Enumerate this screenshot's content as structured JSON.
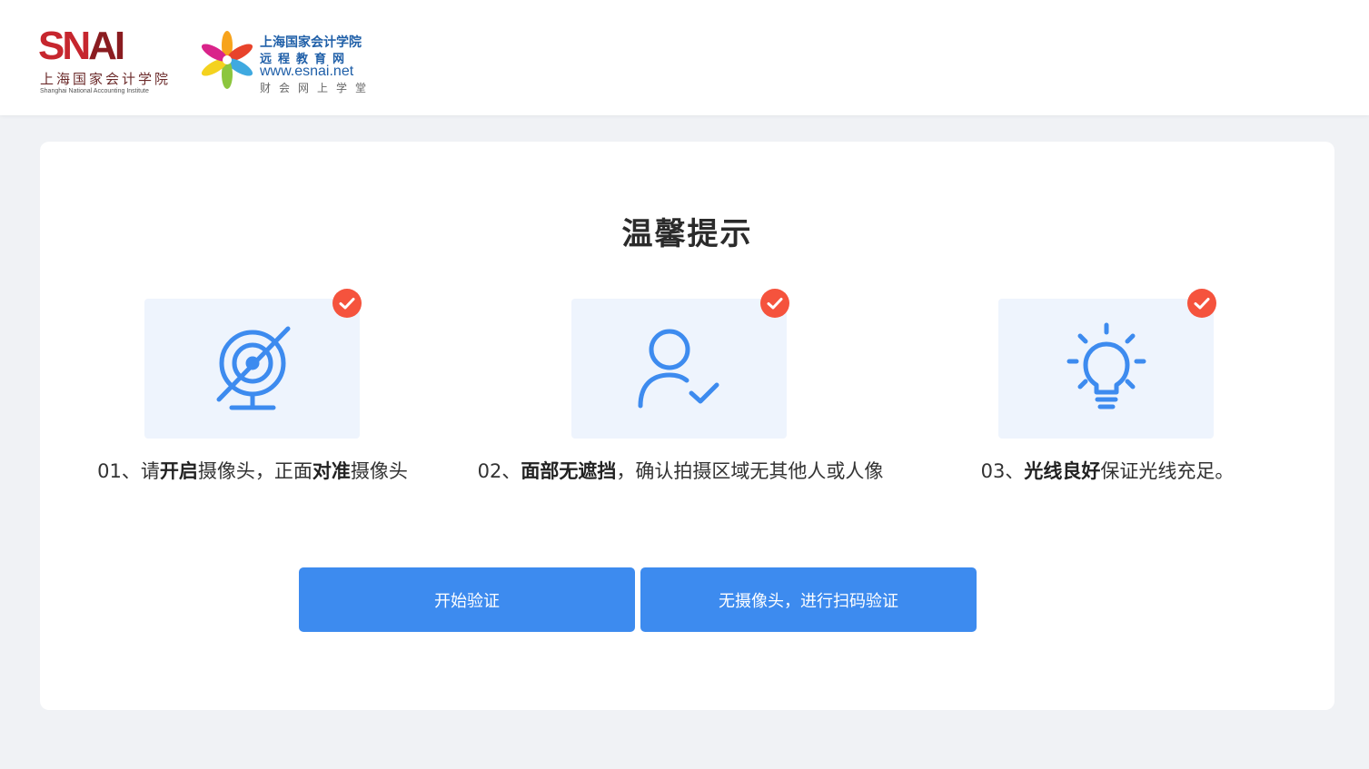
{
  "header": {
    "snai_logo": {
      "wordmark_sn": "SN",
      "wordmark_ai": "AI",
      "name_cn": "上海国家会计学院",
      "name_en": "Shanghai National Accounting Institute"
    },
    "esnai_logo": {
      "line1": "上海国家会计学院",
      "line2": "远程教育网",
      "line3": "www.esnai.net",
      "line4": "财会网上学堂"
    }
  },
  "card": {
    "title": "温馨提示",
    "tips": [
      {
        "icon": "camera-icon",
        "prefix": "01、请",
        "bold1": "开启",
        "mid": "摄像头，正面",
        "bold2": "对准",
        "suffix": "摄像头"
      },
      {
        "icon": "user-check-icon",
        "prefix": "02、",
        "bold1": "面部无遮挡",
        "suffix": "，确认拍摄区域无其他人或人像"
      },
      {
        "icon": "lightbulb-icon",
        "prefix": "03、",
        "bold1": "光线良好",
        "suffix": "保证光线充足。"
      }
    ],
    "buttons": {
      "start": "开始验证",
      "scan": "无摄像头，进行扫码验证"
    }
  },
  "colors": {
    "accent": "#3d8bef",
    "icon_blue": "#3d8bef",
    "check_orange": "#f5533d",
    "tile_bg": "#eef4fd",
    "page_bg": "#f0f2f5"
  }
}
